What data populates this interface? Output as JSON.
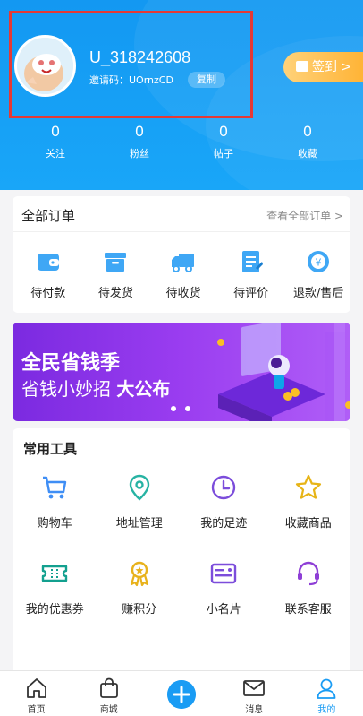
{
  "profile": {
    "username": "U_318242608",
    "invite_label": "邀请码：UOrnzCD",
    "copy_label": "复制",
    "signin_label": "签到 >"
  },
  "stats": [
    {
      "value": "0",
      "label": "关注"
    },
    {
      "value": "0",
      "label": "粉丝"
    },
    {
      "value": "0",
      "label": "帖子"
    },
    {
      "value": "0",
      "label": "收藏"
    }
  ],
  "orders": {
    "title": "全部订单",
    "view_all": "查看全部订单 >",
    "items": [
      {
        "label": "待付款",
        "icon": "wallet-icon"
      },
      {
        "label": "待发货",
        "icon": "box-icon"
      },
      {
        "label": "待收货",
        "icon": "truck-icon"
      },
      {
        "label": "待评价",
        "icon": "review-icon"
      },
      {
        "label": "退款/售后",
        "icon": "refund-icon"
      }
    ]
  },
  "banner": {
    "line1": "全民省钱季",
    "line2_a": "省钱小妙招 ",
    "line2_b": "大公布"
  },
  "tools": {
    "title": "常用工具",
    "items": [
      {
        "label": "购物车",
        "icon": "cart-icon"
      },
      {
        "label": "地址管理",
        "icon": "location-icon"
      },
      {
        "label": "我的足迹",
        "icon": "clock-icon"
      },
      {
        "label": "收藏商品",
        "icon": "star-icon"
      },
      {
        "label": "我的优惠券",
        "icon": "coupon-icon"
      },
      {
        "label": "赚积分",
        "icon": "medal-icon"
      },
      {
        "label": "小名片",
        "icon": "card-icon"
      },
      {
        "label": "联系客服",
        "icon": "headset-icon"
      }
    ]
  },
  "tabbar": [
    {
      "label": "首页",
      "icon": "home-icon"
    },
    {
      "label": "商城",
      "icon": "bag-icon"
    },
    {
      "label": "",
      "icon": "plus-icon"
    },
    {
      "label": "消息",
      "icon": "mail-icon"
    },
    {
      "label": "我的",
      "icon": "user-icon",
      "active": true
    }
  ],
  "colors": {
    "primary": "#1a9cf4",
    "accent_orange": "#ffb02e",
    "banner_purple": "#8a35e8"
  }
}
